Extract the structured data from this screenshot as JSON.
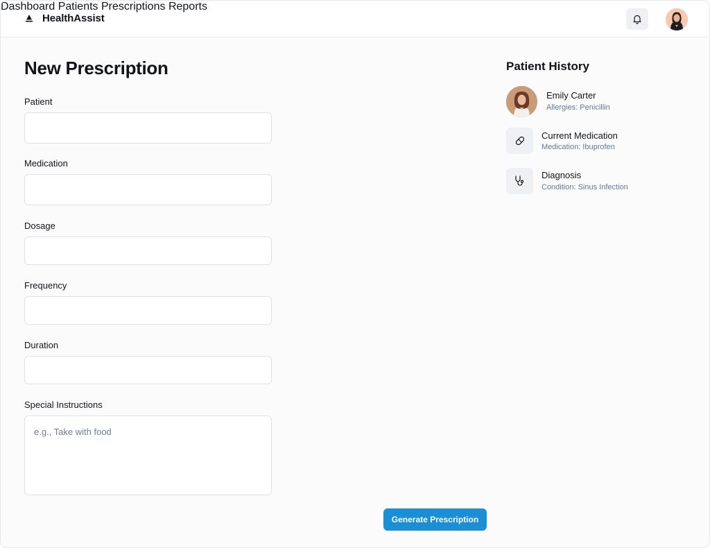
{
  "app": {
    "name": "HealthAssist"
  },
  "nav": {
    "items": [
      {
        "label": "Dashboard"
      },
      {
        "label": "Patients"
      },
      {
        "label": "Prescriptions"
      },
      {
        "label": "Reports"
      }
    ]
  },
  "header": {
    "icons": [
      "bell-icon",
      "user-avatar"
    ]
  },
  "form": {
    "title": "New Prescription",
    "fields": [
      {
        "label": "Patient",
        "value": "",
        "type": "select"
      },
      {
        "label": "Medication",
        "value": "",
        "type": "select"
      },
      {
        "label": "Dosage",
        "value": "",
        "type": "text"
      },
      {
        "label": "Frequency",
        "value": "",
        "type": "text"
      },
      {
        "label": "Duration",
        "value": "",
        "type": "text"
      },
      {
        "label": "Special Instructions",
        "value": "",
        "placeholder": "e.g., Take with food",
        "type": "textarea"
      }
    ],
    "submit_label": "Generate Prescription"
  },
  "history": {
    "title": "Patient History",
    "items": [
      {
        "title": "Emily Carter",
        "detail": "Allergies: Penicillin",
        "icon": "patient-photo"
      },
      {
        "title": "Current Medication",
        "detail": "Medication: Ibuprofen",
        "icon": "pill-icon"
      },
      {
        "title": "Diagnosis",
        "detail": "Condition: Sinus Infection",
        "icon": "stethoscope-icon"
      }
    ]
  },
  "colors": {
    "accent": "#1a8fd6",
    "muted_text": "#5f7a94",
    "icon_bg": "#eef0f3"
  }
}
